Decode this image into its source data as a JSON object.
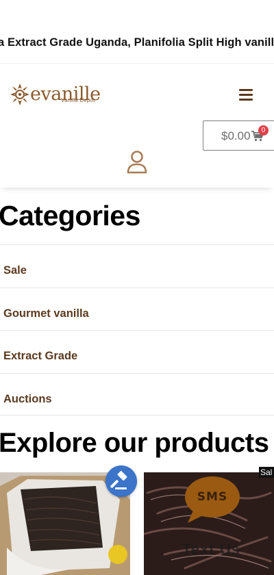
{
  "announcement": {
    "text": "a Extract Grade Uganda, Planifolia Split High vanill"
  },
  "header": {
    "logo_word": "evanille",
    "logo_tagline": "Vanilla Depot",
    "menu_icon": "hamburger-menu-icon",
    "cart": {
      "amount": "$0.00",
      "count": "0",
      "icon": "cart-icon"
    },
    "account_icon": "user-icon"
  },
  "categories": {
    "title": "Categories",
    "items": [
      {
        "label": "Sale"
      },
      {
        "label": "Gourmet vanilla"
      },
      {
        "label": "Extract Grade"
      },
      {
        "label": "Auctions"
      }
    ]
  },
  "explore": {
    "title": "Explore our products",
    "products": [
      {
        "badge": "",
        "image": "vanilla-beans-box-photo"
      },
      {
        "badge": "Sal",
        "image": "split-vanilla-beans-photo"
      }
    ]
  },
  "floating": {
    "auction_icon": "gavel-icon",
    "sms_label": "SMS",
    "text_us_label": "Text Us"
  },
  "colors": {
    "brand_brown": "#5b3a1e",
    "logo_brown": "#8a5a2e",
    "badge_red": "#e0404a",
    "auction_blue": "#3b74c9",
    "sms_brown": "#9a5a12"
  }
}
